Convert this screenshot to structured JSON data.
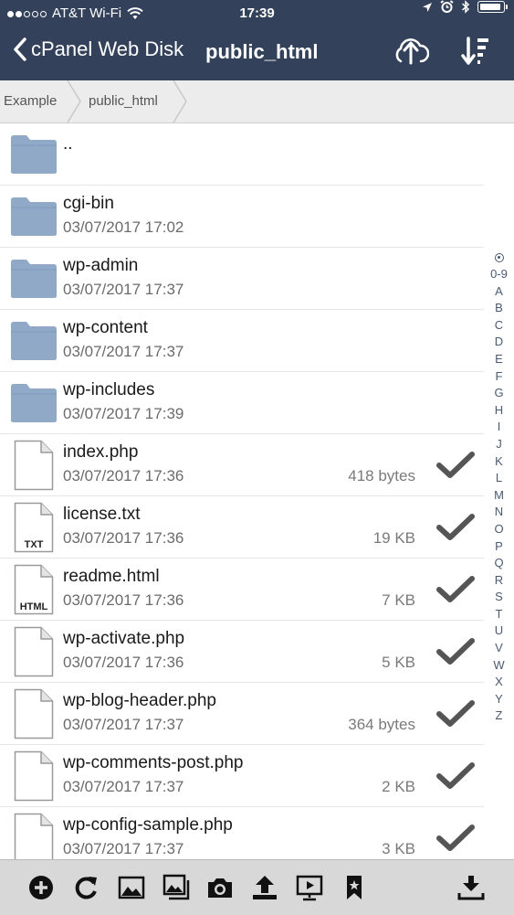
{
  "status": {
    "carrier": "AT&T Wi-Fi",
    "time": "17:39"
  },
  "nav": {
    "back_label": "cPanel Web Disk",
    "title": "public_html"
  },
  "breadcrumb": [
    "Example",
    "public_html"
  ],
  "files": [
    {
      "name": "..",
      "date": "",
      "size": "",
      "kind": "folder",
      "badge": "",
      "checked": false
    },
    {
      "name": "cgi-bin",
      "date": "03/07/2017 17:02",
      "size": "",
      "kind": "folder",
      "badge": "",
      "checked": false
    },
    {
      "name": "wp-admin",
      "date": "03/07/2017 17:37",
      "size": "",
      "kind": "folder",
      "badge": "",
      "checked": false
    },
    {
      "name": "wp-content",
      "date": "03/07/2017 17:37",
      "size": "",
      "kind": "folder",
      "badge": "",
      "checked": false
    },
    {
      "name": "wp-includes",
      "date": "03/07/2017 17:39",
      "size": "",
      "kind": "folder",
      "badge": "",
      "checked": false
    },
    {
      "name": "index.php",
      "date": "03/07/2017 17:36",
      "size": "418 bytes",
      "kind": "file",
      "badge": "",
      "checked": true
    },
    {
      "name": "license.txt",
      "date": "03/07/2017 17:36",
      "size": "19 KB",
      "kind": "file",
      "badge": "TXT",
      "checked": true
    },
    {
      "name": "readme.html",
      "date": "03/07/2017 17:36",
      "size": "7 KB",
      "kind": "file",
      "badge": "HTML",
      "checked": true
    },
    {
      "name": "wp-activate.php",
      "date": "03/07/2017 17:36",
      "size": "5 KB",
      "kind": "file",
      "badge": "",
      "checked": true
    },
    {
      "name": "wp-blog-header.php",
      "date": "03/07/2017 17:37",
      "size": "364 bytes",
      "kind": "file",
      "badge": "",
      "checked": true
    },
    {
      "name": "wp-comments-post.php",
      "date": "03/07/2017 17:37",
      "size": "2 KB",
      "kind": "file",
      "badge": "",
      "checked": true
    },
    {
      "name": "wp-config-sample.php",
      "date": "03/07/2017 17:37",
      "size": "3 KB",
      "kind": "file",
      "badge": "",
      "checked": true
    }
  ],
  "alpha_index": [
    "0-9",
    "A",
    "B",
    "C",
    "D",
    "E",
    "F",
    "G",
    "H",
    "I",
    "J",
    "K",
    "L",
    "M",
    "N",
    "O",
    "P",
    "Q",
    "R",
    "S",
    "T",
    "U",
    "V",
    "W",
    "X",
    "Y",
    "Z"
  ],
  "toolbar": {
    "icons": [
      "add-icon",
      "refresh-icon",
      "image-icon",
      "gallery-icon",
      "camera-icon",
      "upload-icon",
      "slideshow-icon",
      "bookmark-icon",
      "download-icon"
    ]
  },
  "colors": {
    "navbar": "#33425a",
    "folder": "#8fa9c6",
    "check": "#555555",
    "toolbar": "#d8d8d8"
  }
}
